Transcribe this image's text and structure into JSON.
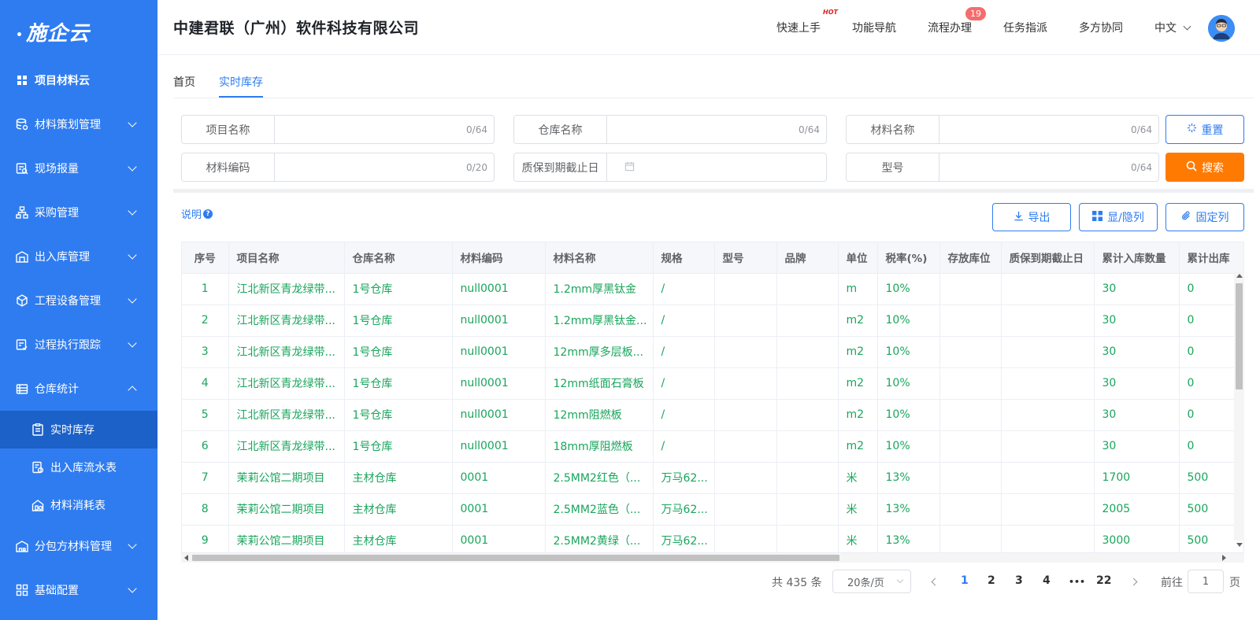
{
  "brand": {
    "logo_text": "施企云"
  },
  "header": {
    "company": "中建君联（广州）软件科技有限公司",
    "nav": [
      {
        "label": "快速上手",
        "badge": "HOT"
      },
      {
        "label": "功能导航"
      },
      {
        "label": "流程办理",
        "count": "19"
      },
      {
        "label": "任务指派"
      },
      {
        "label": "多方协同"
      }
    ],
    "language": "中文"
  },
  "sidebar": {
    "top_item": "项目材料云",
    "items": [
      {
        "label": "材料策划管理",
        "icon": "database-icon",
        "expanded": false
      },
      {
        "label": "现场报量",
        "icon": "report-icon",
        "expanded": false
      },
      {
        "label": "采购管理",
        "icon": "org-chart-icon",
        "expanded": false
      },
      {
        "label": "出入库管理",
        "icon": "warehouse-icon",
        "expanded": false
      },
      {
        "label": "工程设备管理",
        "icon": "cube-icon",
        "expanded": false
      },
      {
        "label": "过程执行跟踪",
        "icon": "tracking-icon",
        "expanded": false
      },
      {
        "label": "仓库统计",
        "icon": "stats-icon",
        "expanded": true
      }
    ],
    "sub_items": [
      {
        "label": "实时库存",
        "icon": "inventory-icon",
        "active": true
      },
      {
        "label": "出入库流水表",
        "icon": "ledger-icon",
        "active": false
      },
      {
        "label": "材料消耗表",
        "icon": "consumption-icon",
        "active": false
      }
    ],
    "bottom_items": [
      {
        "label": "分包方材料管理",
        "icon": "subcontract-icon",
        "expanded": false
      },
      {
        "label": "基础配置",
        "icon": "grid-config-icon",
        "expanded": false
      }
    ]
  },
  "tabs": [
    {
      "label": "首页",
      "active": false
    },
    {
      "label": "实时库存",
      "active": true
    }
  ],
  "filters": {
    "project_name": {
      "label": "项目名称",
      "counter": "0/64"
    },
    "warehouse_name": {
      "label": "仓库名称",
      "counter": "0/64"
    },
    "material_name": {
      "label": "材料名称",
      "counter": "0/64"
    },
    "material_code": {
      "label": "材料编码",
      "counter": "0/20"
    },
    "warranty_date": {
      "label": "质保到期截止日"
    },
    "model": {
      "label": "型号",
      "counter": "0/64"
    },
    "reset_label": "重置",
    "search_label": "搜索"
  },
  "toolbar": {
    "description": "说明",
    "export_label": "导出",
    "show_hide_label": "显/隐列",
    "fix_columns_label": "固定列"
  },
  "table": {
    "columns": [
      "序号",
      "项目名称",
      "仓库名称",
      "材料编码",
      "材料名称",
      "规格",
      "型号",
      "品牌",
      "单位",
      "税率(%)",
      "存放库位",
      "质保到期截止日",
      "累计入库数量",
      "累计出库"
    ],
    "rows": [
      [
        "1",
        "江北新区青龙绿带...",
        "1号仓库",
        "null0001",
        "1.2mm厚黑钛金",
        "/",
        "",
        "",
        "m",
        "10%",
        "",
        "",
        "30",
        "0"
      ],
      [
        "2",
        "江北新区青龙绿带...",
        "1号仓库",
        "null0001",
        "1.2mm厚黑钛金...",
        "/",
        "",
        "",
        "m2",
        "10%",
        "",
        "",
        "30",
        "0"
      ],
      [
        "3",
        "江北新区青龙绿带...",
        "1号仓库",
        "null0001",
        "12mm厚多层板...",
        "/",
        "",
        "",
        "m2",
        "10%",
        "",
        "",
        "30",
        "0"
      ],
      [
        "4",
        "江北新区青龙绿带...",
        "1号仓库",
        "null0001",
        "12mm纸面石膏板",
        "/",
        "",
        "",
        "m2",
        "10%",
        "",
        "",
        "30",
        "0"
      ],
      [
        "5",
        "江北新区青龙绿带...",
        "1号仓库",
        "null0001",
        "12mm阻燃板",
        "/",
        "",
        "",
        "m2",
        "10%",
        "",
        "",
        "30",
        "0"
      ],
      [
        "6",
        "江北新区青龙绿带...",
        "1号仓库",
        "null0001",
        "18mm厚阻燃板",
        "/",
        "",
        "",
        "m2",
        "10%",
        "",
        "",
        "30",
        "0"
      ],
      [
        "7",
        "茉莉公馆二期项目",
        "主材仓库",
        "0001",
        "2.5MM2红色（...",
        "万马62...",
        "",
        "",
        "米",
        "13%",
        "",
        "",
        "1700",
        "500"
      ],
      [
        "8",
        "茉莉公馆二期项目",
        "主材仓库",
        "0001",
        "2.5MM2蓝色（...",
        "万马62...",
        "",
        "",
        "米",
        "13%",
        "",
        "",
        "2005",
        "500"
      ],
      [
        "9",
        "茉莉公馆二期项目",
        "主材仓库",
        "0001",
        "2.5MM2黄绿（...",
        "万马62...",
        "",
        "",
        "米",
        "13%",
        "",
        "",
        "3000",
        "500"
      ]
    ]
  },
  "pagination": {
    "total": "共 435 条",
    "page_size": "20条/页",
    "pages": [
      "1",
      "2",
      "3",
      "4",
      "22"
    ],
    "ellipsis": "•••",
    "current": "1",
    "goto_label": "前往",
    "goto_value": "1",
    "goto_suffix": "页"
  },
  "colors": {
    "primary": "#2f7cf0",
    "search": "#ff7a00",
    "cell_text": "#19a55c",
    "badge": "#f56c6c"
  }
}
